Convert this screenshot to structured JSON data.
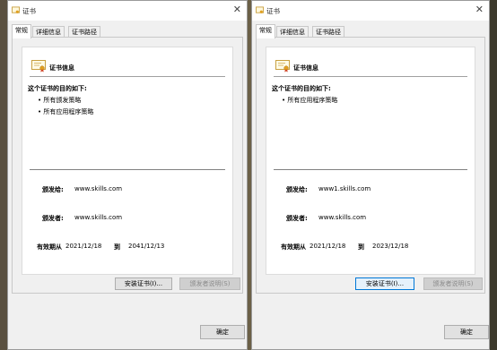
{
  "windows": [
    {
      "title": "证书",
      "tabs": [
        "常规",
        "详细信息",
        "证书路径"
      ],
      "info_title": "证书信息",
      "purpose_label": "这个证书的目的如下:",
      "purposes": [
        "• 所有颁发策略",
        "• 所有应用程序策略"
      ],
      "issued_to_label": "颁发给:",
      "issued_to": "www.skills.com",
      "issued_by_label": "颁发者:",
      "issued_by": "www.skills.com",
      "valid_label": "有效期从",
      "valid_from": "2021/12/18",
      "valid_to_label": "到",
      "valid_to": "2041/12/13",
      "install_button": "安装证书(I)...",
      "issuer_statement_button": "颁发者说明(S)",
      "ok_button": "确定"
    },
    {
      "title": "证书",
      "tabs": [
        "常规",
        "详细信息",
        "证书路径"
      ],
      "info_title": "证书信息",
      "purpose_label": "这个证书的目的如下:",
      "purposes": [
        "• 所有应用程序策略"
      ],
      "issued_to_label": "颁发给:",
      "issued_to": "www1.skills.com",
      "issued_by_label": "颁发者:",
      "issued_by": "www.skills.com",
      "valid_label": "有效期从",
      "valid_from": "2021/12/18",
      "valid_to_label": "到",
      "valid_to": "2023/12/18",
      "install_button": "安装证书(I)...",
      "issuer_statement_button": "颁发者说明(S)",
      "ok_button": "确定"
    }
  ],
  "icons": {
    "title": "certificate-icon",
    "info": "certificate-ribbon-icon",
    "close": "close-icon"
  }
}
